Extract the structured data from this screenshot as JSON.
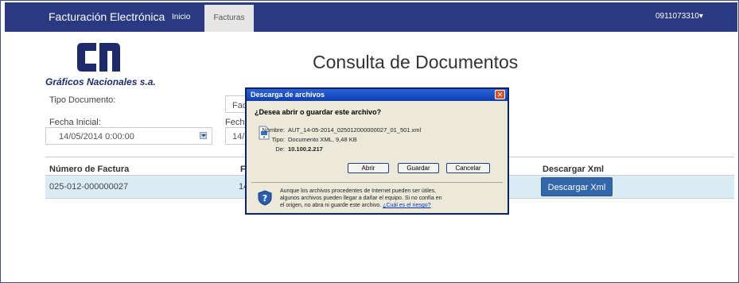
{
  "navbar": {
    "brand": "Facturación Electrónica",
    "items": [
      {
        "label": "Inicio"
      },
      {
        "label": "Facturas"
      }
    ],
    "user": "0911073310▾"
  },
  "logo": {
    "text": "Gráficos Nacionales s.a."
  },
  "page": {
    "title": "Consulta de Documentos"
  },
  "form": {
    "tipo_documento_label": "Tipo Documento:",
    "tipo_documento_value": "Fac",
    "fecha_inicial_label": "Fecha Inicial:",
    "fecha_inicial_value": "14/05/2014 0:00:00",
    "fecha_final_label": "Fecha",
    "fecha_final_value": "14/"
  },
  "table": {
    "headers": [
      "Número de Factura",
      "F",
      "Descargar Xml"
    ],
    "rows": [
      {
        "numero": "025-012-000000027",
        "fecha": "14",
        "action": "Descargar Xml"
      }
    ]
  },
  "dialog": {
    "title": "Descarga de archivos",
    "close": "✕",
    "question": "¿Desea abrir o guardar este archivo?",
    "fields": [
      {
        "key": "Nombre:",
        "value": "AUT_14-05-2014_025012000000027_01_501.xml"
      },
      {
        "key": "Tipo:",
        "value": "Documento XML, 9,48 KB"
      },
      {
        "key": "De:",
        "value": "10.100.2.217"
      }
    ],
    "buttons": {
      "open": "Abrir",
      "save": "Guardar",
      "cancel": "Cancelar"
    },
    "warning_lines": [
      "Aunque los archivos procedentes de Internet pueden ser útiles,",
      "algunos archivos pueden llegar a dañar el equipo. Si no confía en",
      "el origen, no abra ni guarde este archivo."
    ],
    "risk_link": "¿Cuál es el riesgo?"
  },
  "colors": {
    "navbar": "#2a3a82",
    "table_row": "#d9ecf3",
    "xml_button": "#3366aa",
    "dialog_title": "#0b3fb2"
  }
}
